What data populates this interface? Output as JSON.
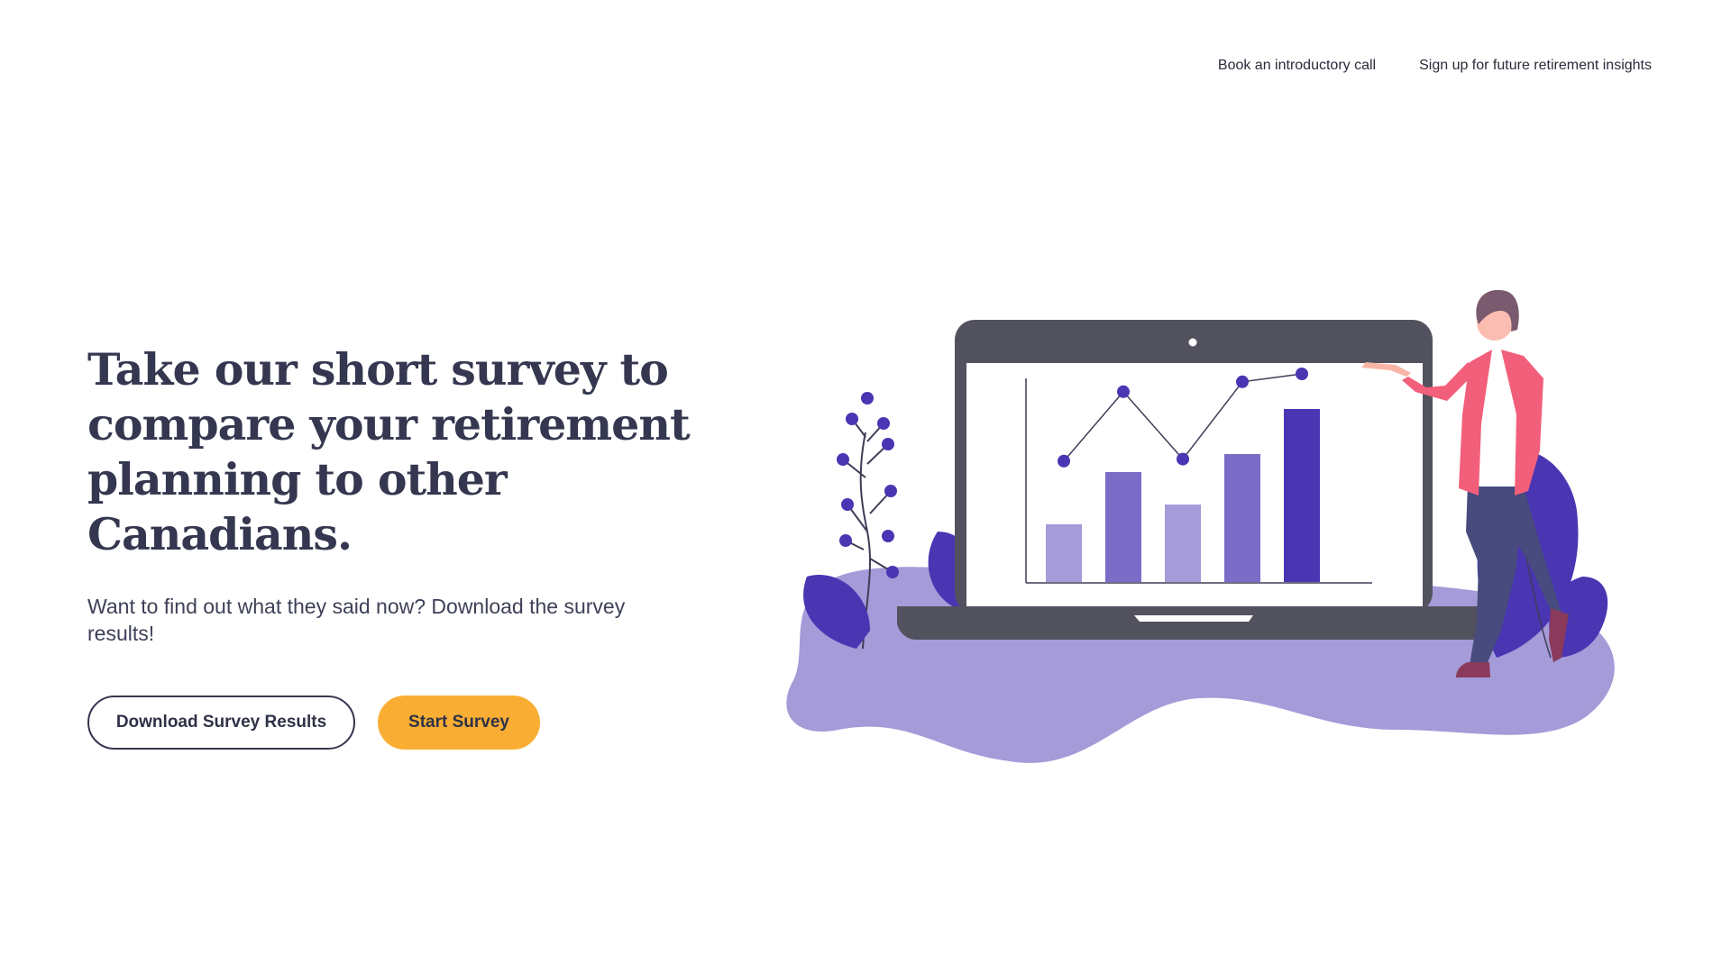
{
  "nav": {
    "items": [
      {
        "label": "Book an introductory call"
      },
      {
        "label": "Sign up for future retirement insights"
      }
    ]
  },
  "hero": {
    "title": "Take our short survey to compare your retirement planning to other Canadians.",
    "subtitle": "Want to find out what they said now? Download the survey results!",
    "buttons": {
      "download_label": "Download Survey Results",
      "start_label": "Start Survey"
    }
  },
  "illustration": {
    "icons": [
      "laptop-icon",
      "person-icon",
      "plant-icon",
      "leaf-icon",
      "bar-chart-icon"
    ],
    "chart_bars": [
      0.32,
      0.61,
      0.43,
      0.71,
      0.96
    ],
    "chart_line": [
      0.56,
      0.91,
      0.57,
      0.96,
      1.0
    ]
  },
  "colors": {
    "accent": "#f9ae33",
    "text_dark": "#34374f",
    "purple_dark": "#4a35b3",
    "purple_mid": "#7b6cc8",
    "purple_light": "#a49bd8",
    "laptop_gray": "#52525f",
    "jacket_pink": "#f25f7a"
  }
}
